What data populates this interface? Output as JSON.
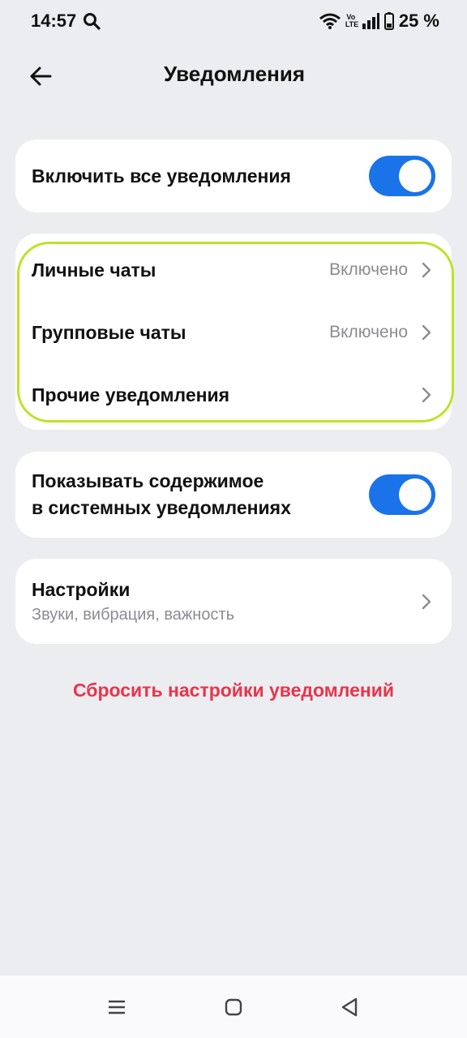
{
  "status_bar": {
    "time": "14:57",
    "network_label": "Vo\nLTE",
    "battery_percent": "25 %"
  },
  "header": {
    "title": "Уведомления"
  },
  "all_notifications": {
    "label": "Включить все уведомления",
    "enabled": true
  },
  "chat_settings": [
    {
      "label": "Личные чаты",
      "value": "Включено"
    },
    {
      "label": "Групповые чаты",
      "value": "Включено"
    },
    {
      "label": "Прочие уведомления",
      "value": ""
    }
  ],
  "show_content": {
    "label_line1": "Показывать содержимое",
    "label_line2": "в системных уведомлениях",
    "enabled": true
  },
  "settings": {
    "title": "Настройки",
    "subtitle": "Звуки, вибрация, важность"
  },
  "reset_label": "Сбросить настройки уведомлений",
  "colors": {
    "background": "#ECEDF1",
    "toggle_on": "#1A73E8",
    "reset_red": "#E8344A",
    "highlight": "#BFE127"
  },
  "icons": {
    "status": [
      "search-icon",
      "wifi-icon",
      "volte-icon",
      "signal-icon",
      "battery-icon"
    ],
    "header": [
      "back-arrow-icon"
    ],
    "nav": [
      "menu-icon",
      "home-icon",
      "back-icon"
    ]
  }
}
